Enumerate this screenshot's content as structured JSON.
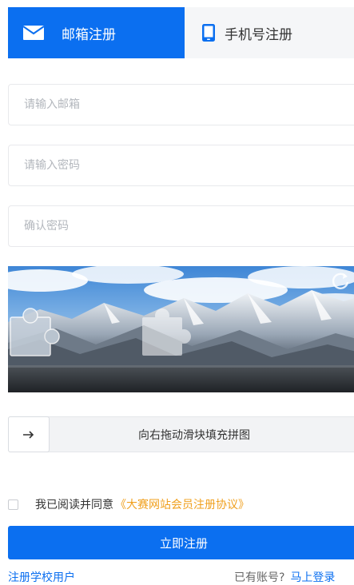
{
  "tabs": [
    {
      "label": "邮箱注册",
      "icon": "envelope-icon",
      "active": true
    },
    {
      "label": "手机号注册",
      "icon": "mobile-phone-icon",
      "active": false
    }
  ],
  "form": {
    "email_placeholder": "请输入邮箱",
    "password_placeholder": "请输入密码",
    "confirm_placeholder": "确认密码"
  },
  "captcha": {
    "refresh_icon": "refresh-icon",
    "slider_icon": "arrow-right-icon",
    "slider_text": "向右拖动滑块填充拼图"
  },
  "agreement": {
    "checked": false,
    "text": "我已阅读并同意",
    "link": "《大赛网站会员注册协议》"
  },
  "submit_label": "立即注册",
  "footer": {
    "school_register": "注册学校用户",
    "have_account": "已有账号?",
    "login_link": "马上登录"
  },
  "colors": {
    "primary": "#0b6ff0",
    "link_orange": "#f0a01e"
  }
}
